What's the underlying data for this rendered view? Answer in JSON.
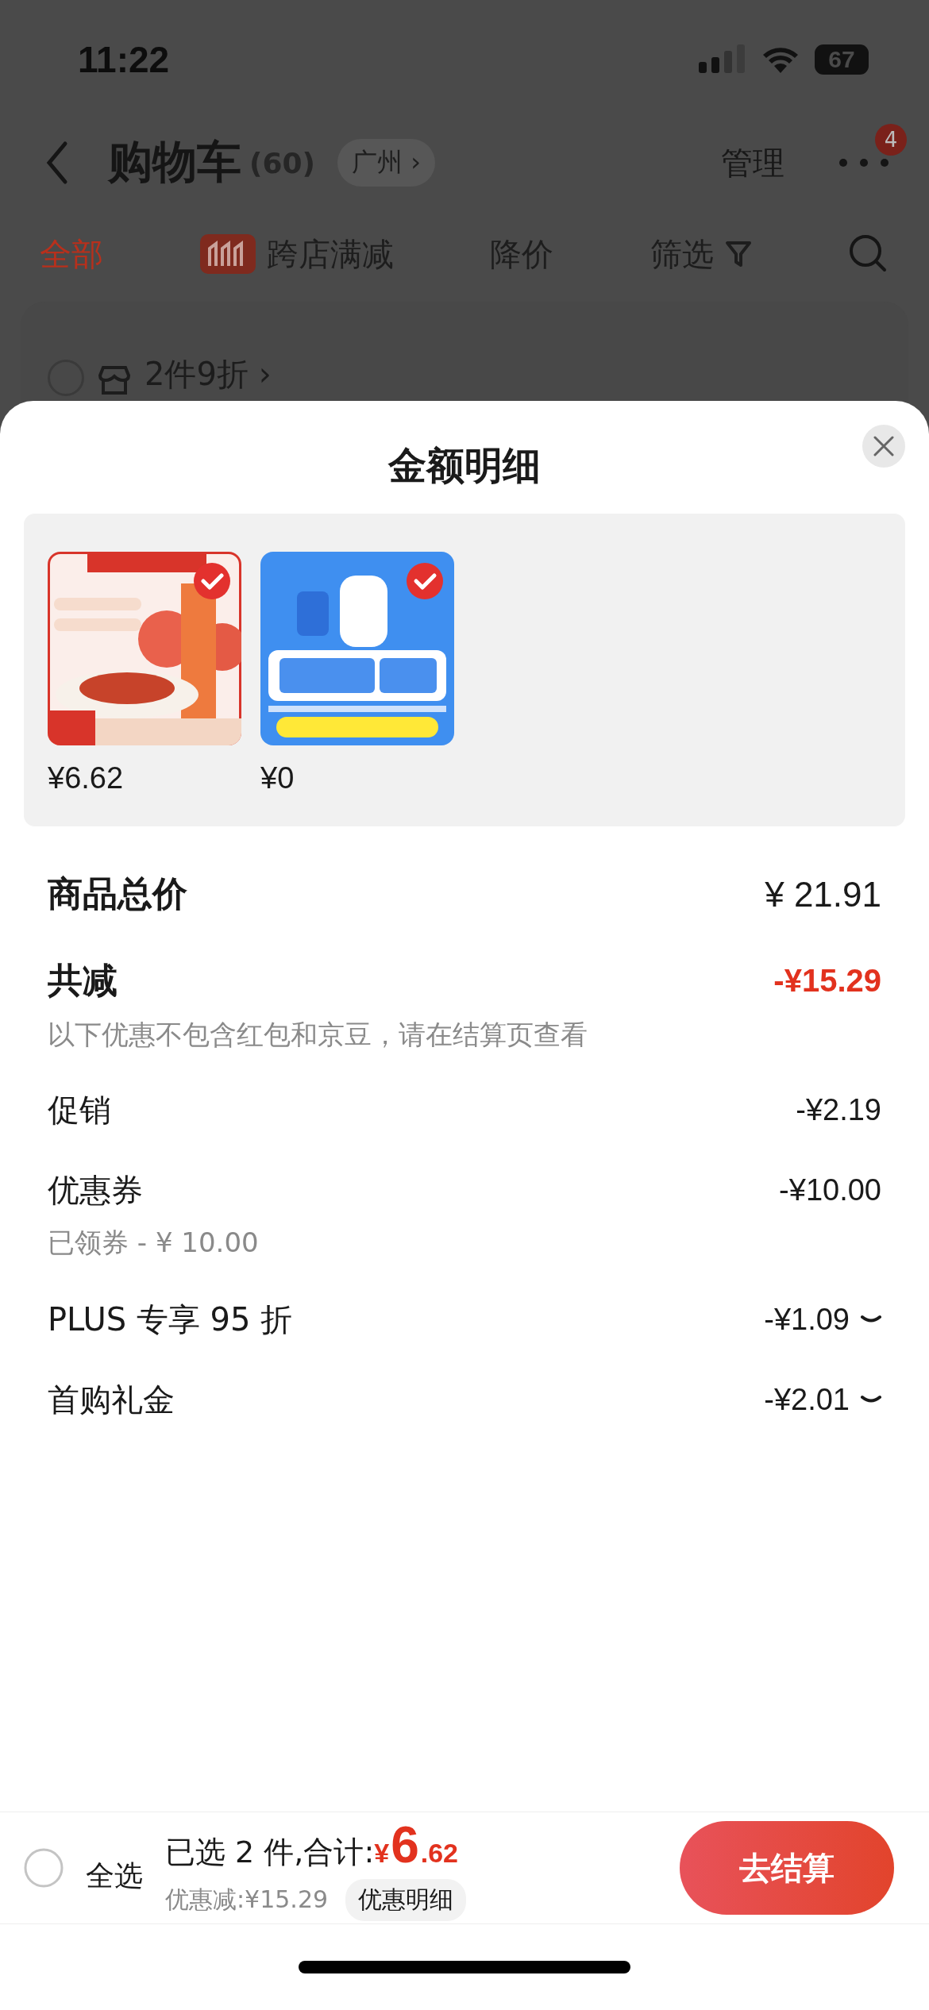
{
  "status_bar": {
    "time": "11:22",
    "battery": "67"
  },
  "cart_header": {
    "title": "购物车",
    "count": "(60)",
    "location": "广州",
    "location_arrow": "›",
    "manage": "管理",
    "badge": "4"
  },
  "filter_tabs": [
    {
      "label": "全部",
      "selected": true,
      "kind": "text"
    },
    {
      "label": "跨店满减",
      "selected": false,
      "kind": "promo"
    },
    {
      "label": "降价",
      "selected": false,
      "kind": "text"
    },
    {
      "label": "筛选",
      "selected": false,
      "kind": "filter"
    }
  ],
  "store_row": {
    "label": "2件9折",
    "arrow": "›",
    "checked": false
  },
  "sheet": {
    "title": "金额明细",
    "products": [
      {
        "kind": "pasta",
        "price": "¥6.62",
        "selected": true
      },
      {
        "kind": "sim",
        "price": "¥0",
        "selected": true
      }
    ],
    "total": {
      "label": "商品总价",
      "value": "¥ 21.91"
    },
    "discount": {
      "label": "共减",
      "value": "-¥15.29",
      "note": "以下优惠不包含红包和京豆，请在结算页查看"
    },
    "lines": [
      {
        "label": "促销",
        "value": "-¥2.19",
        "kind": "plain"
      },
      {
        "label": "优惠券",
        "value": "-¥10.00",
        "kind": "plain",
        "note": "已领券 - ¥ 10.00"
      },
      {
        "label": "PLUS 专享 95 折",
        "value": "-¥1.09",
        "kind": "expandable"
      },
      {
        "label": "首购礼金",
        "value": "-¥2.01",
        "kind": "expandable"
      }
    ]
  },
  "bottom_bar": {
    "select_all": {
      "label": "全选",
      "checked": false
    },
    "summary": "已选 2 件,合计:",
    "currency": "¥",
    "amount_int": "6",
    "amount_dec": ".62",
    "saved": "优惠减:¥15.29",
    "detail_button": "优惠明细",
    "checkout": "去结算"
  }
}
